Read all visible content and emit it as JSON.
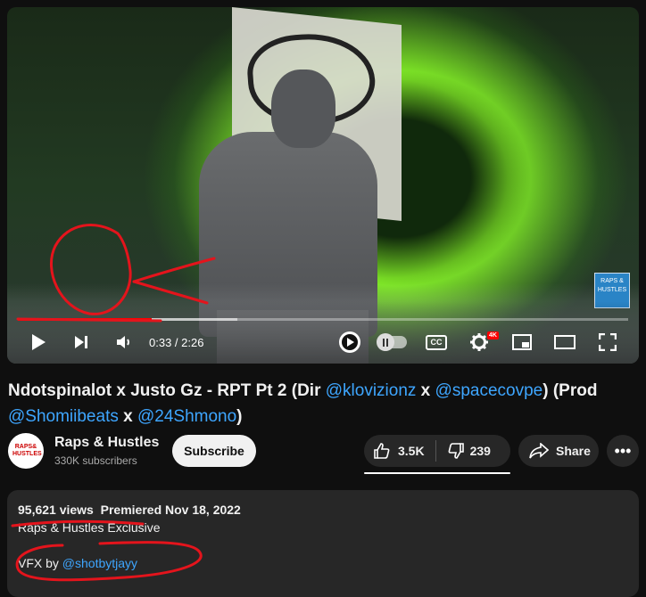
{
  "player": {
    "watermark_text": "RAPS & HUSTLES",
    "progress_fraction": 0.219,
    "buffered_fraction": 0.36,
    "time_current": "0:33",
    "time_separator": " / ",
    "time_total": "2:26",
    "cc_label": "CC",
    "quality_badge": "4K",
    "accent_color": "#ff0000",
    "icons": [
      "play-icon",
      "next-icon",
      "volume-icon",
      "shield-play-icon",
      "autoplay-toggle",
      "cc-icon",
      "settings-gear-icon",
      "miniplayer-icon",
      "theater-icon",
      "fullscreen-icon"
    ]
  },
  "video": {
    "title_prefix": "Ndotspinalot x Justo Gz - RPT Pt 2 (Dir ",
    "mention_director_1": "@klovizionz",
    "title_x1": " x ",
    "mention_director_2": "@spacecovpe",
    "title_prod": ") (Prod ",
    "mention_producer_1": "@Shomiibeats",
    "title_x2": " x ",
    "mention_producer_2": "@24Shmono",
    "title_close": ")"
  },
  "channel": {
    "avatar_text": "RAPS& HUSTLES",
    "name": "Raps & Hustles",
    "subscribers": "330K subscribers",
    "subscribe_label": "Subscribe"
  },
  "actions": {
    "likes": "3.5K",
    "dislikes": "239",
    "share_label": "Share",
    "more_label": "•••"
  },
  "description": {
    "views": "95,621 views",
    "premiered": "Premiered Nov 18, 2022",
    "line1": "Raps & Hustles Exclusive",
    "line2_prefix": "VFX by ",
    "line2_mention": "@shotbytjayy"
  }
}
